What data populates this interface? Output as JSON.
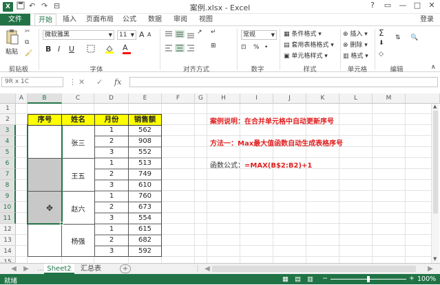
{
  "window": {
    "title": "案例.xlsx - Excel",
    "controls": [
      "?",
      "▭",
      "—",
      "□",
      "✕"
    ]
  },
  "quick_access": {
    "save_icon": "save-icon",
    "undo_icon": "undo-icon",
    "redo_icon": "redo-icon"
  },
  "tabs": {
    "file": "文件",
    "items": [
      "开始",
      "插入",
      "页面布局",
      "公式",
      "数据",
      "审阅",
      "视图"
    ],
    "active": "开始",
    "login": "登录"
  },
  "ribbon": {
    "clipboard": {
      "paste": "粘贴",
      "label": "剪贴板"
    },
    "font": {
      "name": "微软雅黑",
      "size": "11",
      "bold": "B",
      "italic": "I",
      "underline": "U",
      "grow": "A",
      "shrink": "A",
      "label": "字体",
      "font_color": "#ff0000"
    },
    "alignment": {
      "label": "对齐方式"
    },
    "number": {
      "format": "常规",
      "percent": "%",
      "label": "数字"
    },
    "styles": {
      "conditional": "条件格式",
      "table": "套用表格格式",
      "cell": "单元格样式",
      "label": "样式"
    },
    "cells": {
      "insert": "插入",
      "delete": "删除",
      "format": "格式",
      "label": "单元格"
    },
    "editing": {
      "sum": "Σ",
      "label": "编辑"
    }
  },
  "formula_bar": {
    "name_box": "9R x 1C",
    "fx": "fx",
    "formula": ""
  },
  "columns": [
    "A",
    "B",
    "C",
    "D",
    "E",
    "F",
    "G",
    "H",
    "I",
    "J",
    "K",
    "L",
    "M"
  ],
  "selected_column": "B",
  "rows": [
    "1",
    "2",
    "3",
    "4",
    "5",
    "6",
    "7",
    "8",
    "9",
    "10",
    "11",
    "12",
    "13",
    "14",
    "15"
  ],
  "selected_rows": [
    "3",
    "4",
    "5",
    "6",
    "7",
    "8",
    "9",
    "10",
    "11"
  ],
  "table": {
    "headers": [
      "序号",
      "姓名",
      "月份",
      "销售额"
    ],
    "groups": [
      {
        "name": "张三",
        "months": [
          "1",
          "2",
          "3"
        ],
        "sales": [
          "562",
          "908",
          "552"
        ]
      },
      {
        "name": "王五",
        "months": [
          "1",
          "2",
          "3"
        ],
        "sales": [
          "513",
          "749",
          "610"
        ]
      },
      {
        "name": "赵六",
        "months": [
          "1",
          "2",
          "3"
        ],
        "sales": [
          "760",
          "673",
          "554"
        ]
      },
      {
        "name": "杨强",
        "months": [
          "1",
          "2",
          "3"
        ],
        "sales": [
          "615",
          "682",
          "592"
        ]
      }
    ],
    "header_color": "#ffff00"
  },
  "notes": {
    "line1": "案例说明：在合并单元格中自动更新序号",
    "line2": "方法一：Max最大值函数自动生成表格序号",
    "line3_label": "函数公式：",
    "line3_formula": "=MAX(B$2:B2)+1"
  },
  "sheets": {
    "items": [
      "Sheet2",
      "汇总表"
    ],
    "active": "Sheet2",
    "add": "+"
  },
  "status": {
    "text": "就绪",
    "zoom": "100%",
    "zoom_level": 1.0
  },
  "colors": {
    "accent": "#217346",
    "note_red": "#e02020"
  }
}
